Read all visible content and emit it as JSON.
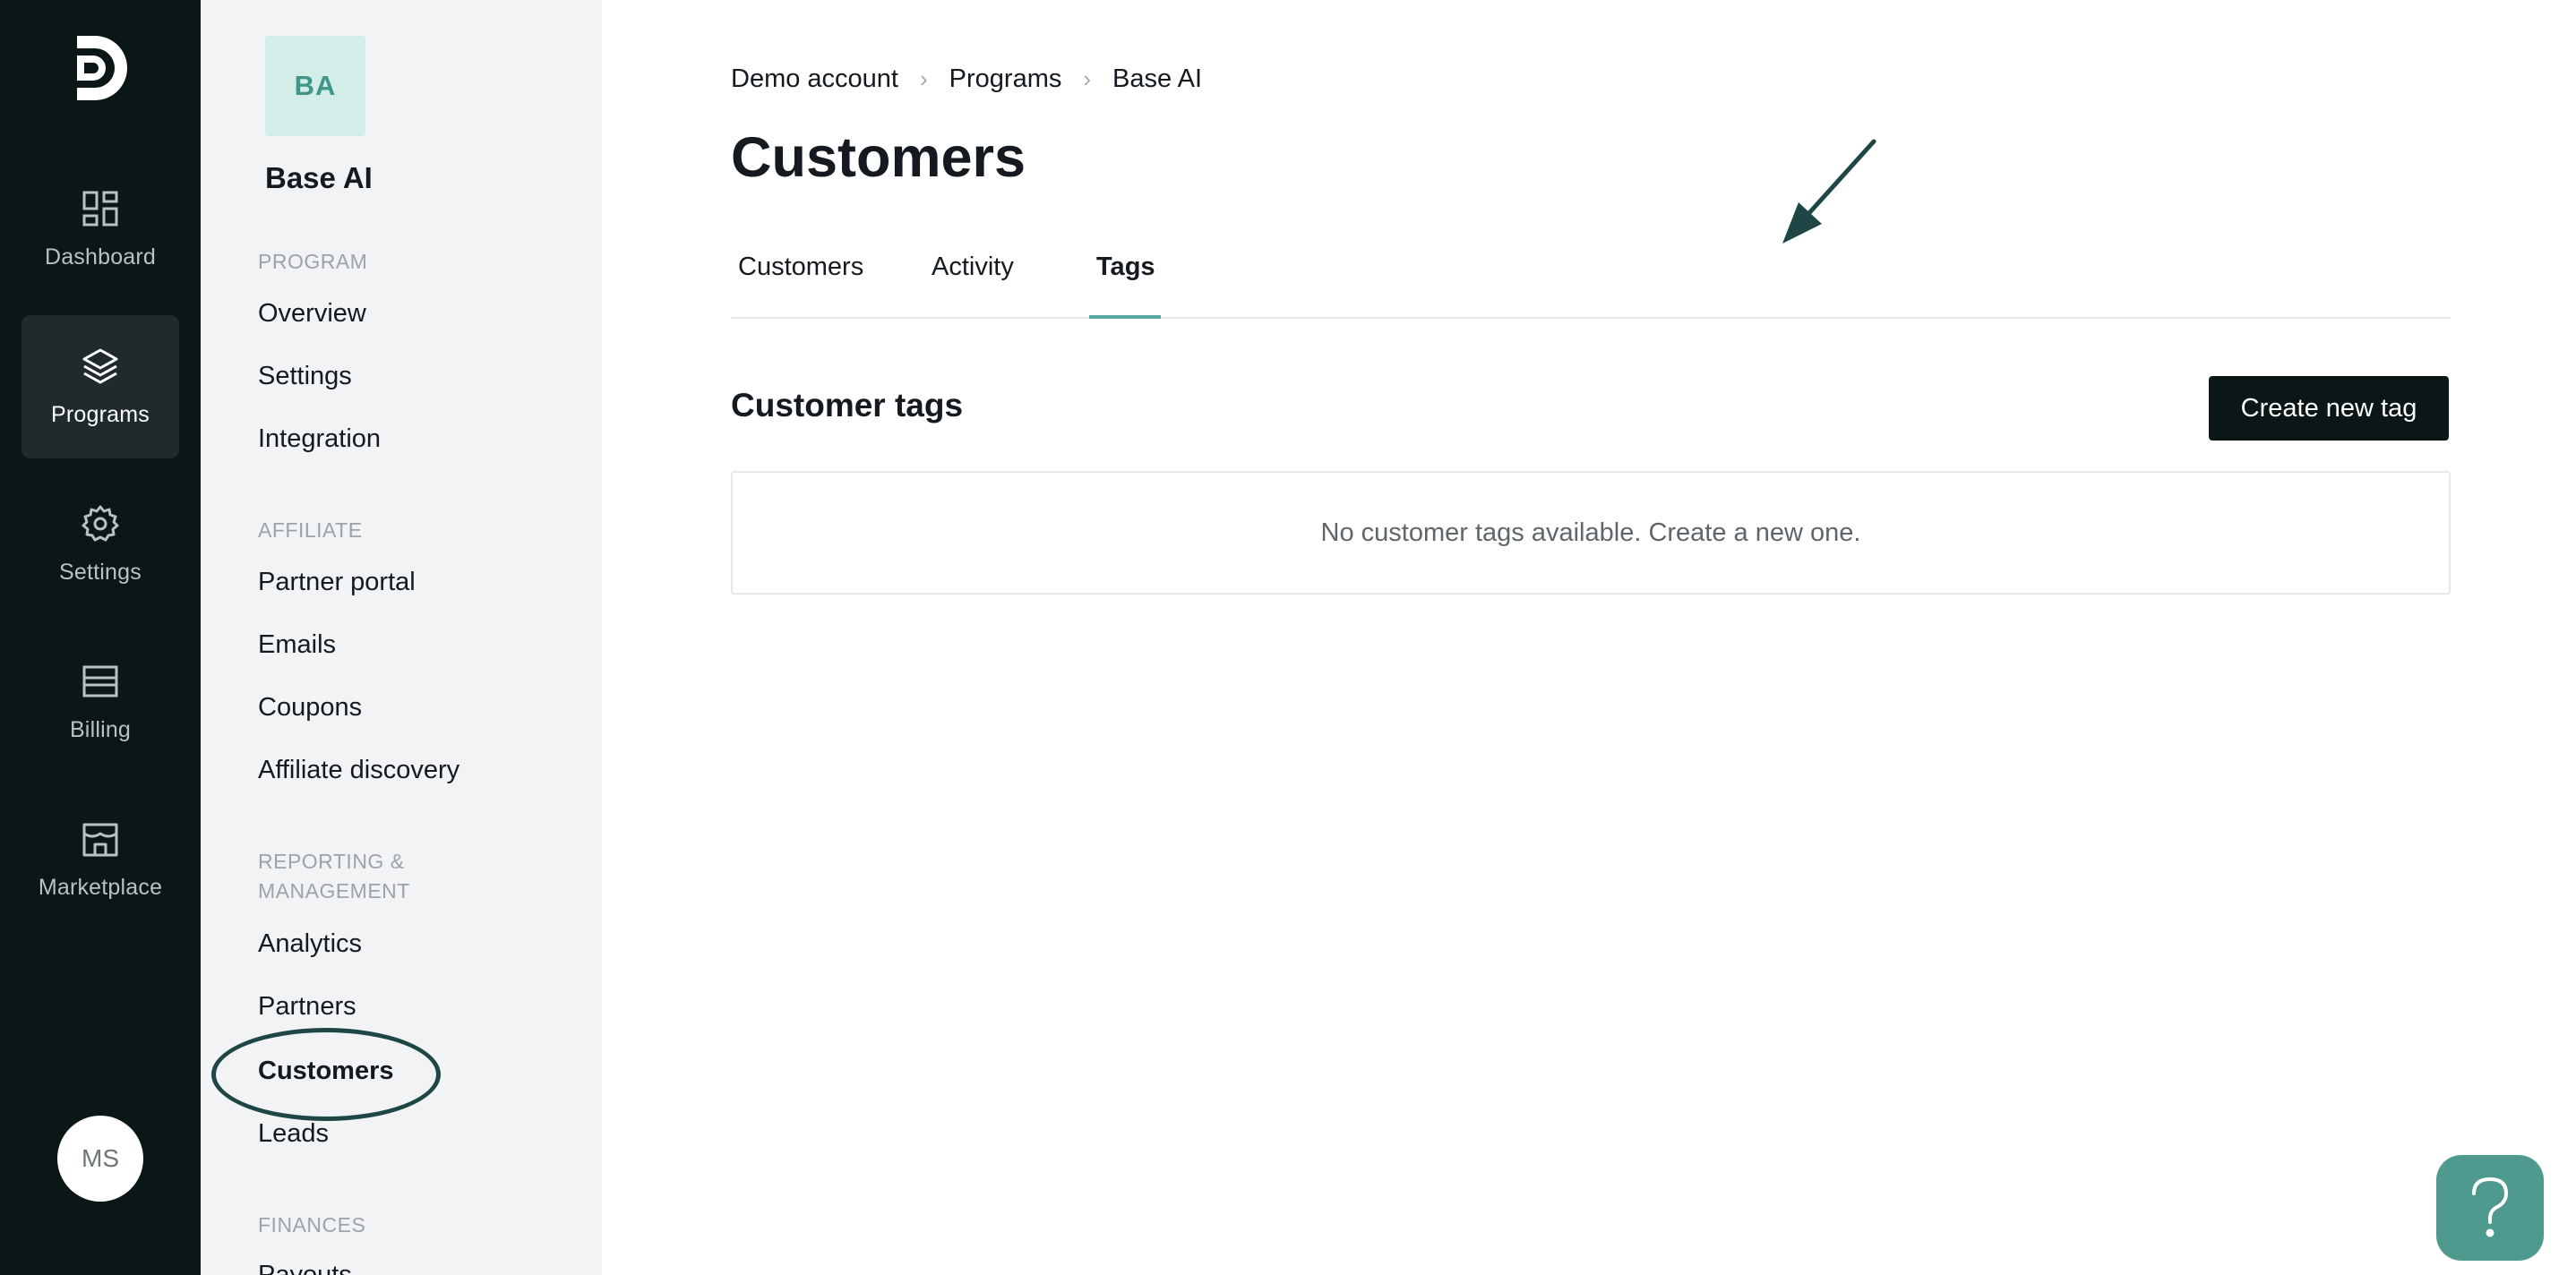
{
  "rail": {
    "items": [
      {
        "label": "Dashboard",
        "icon": "dashboard-icon"
      },
      {
        "label": "Programs",
        "icon": "layers-icon",
        "active": true
      },
      {
        "label": "Settings",
        "icon": "gear-icon"
      },
      {
        "label": "Billing",
        "icon": "billing-icon"
      },
      {
        "label": "Marketplace",
        "icon": "store-icon"
      }
    ],
    "avatar": "MS"
  },
  "sidebar": {
    "badge": "BA",
    "program_name": "Base AI",
    "sections": [
      {
        "heading": "PROGRAM",
        "items": [
          "Overview",
          "Settings",
          "Integration"
        ]
      },
      {
        "heading": "AFFILIATE",
        "items": [
          "Partner portal",
          "Emails",
          "Coupons",
          "Affiliate discovery"
        ]
      },
      {
        "heading": "REPORTING & MANAGEMENT",
        "items": [
          "Analytics",
          "Partners",
          "Customers",
          "Leads"
        ]
      },
      {
        "heading": "FINANCES",
        "items": [
          "Payouts"
        ]
      }
    ],
    "active_item": "Customers"
  },
  "breadcrumb": [
    "Demo account",
    "Programs",
    "Base AI"
  ],
  "page_title": "Customers",
  "tabs": [
    "Customers",
    "Activity",
    "Tags"
  ],
  "active_tab": "Tags",
  "section_title": "Customer tags",
  "create_button": "Create new tag",
  "empty_message": "No customer tags available. Create a new one.",
  "help_icon": "question-icon",
  "colors": {
    "rail_bg": "#0b1616",
    "accent": "#55a89b",
    "help_bg": "#4f9a8e",
    "badge_bg": "#d3ede9"
  }
}
